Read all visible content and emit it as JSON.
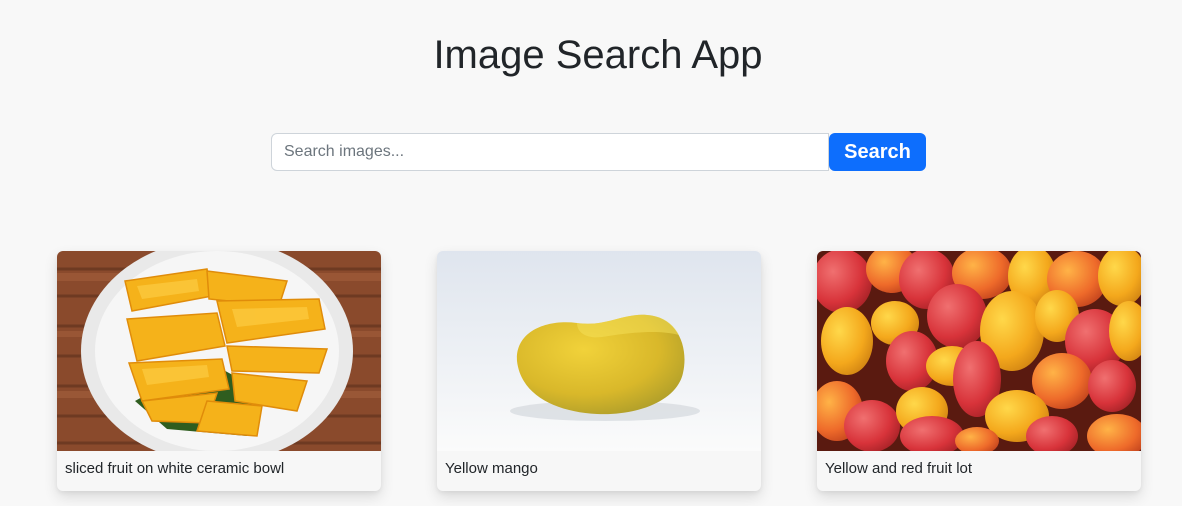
{
  "app": {
    "title": "Image Search App"
  },
  "search": {
    "placeholder": "Search images...",
    "value": "",
    "button_label": "Search",
    "button_color": "#0d6efd"
  },
  "results": [
    {
      "caption": "sliced fruit on white ceramic bowl"
    },
    {
      "caption": "Yellow mango"
    },
    {
      "caption": "Yellow and red fruit lot"
    }
  ]
}
